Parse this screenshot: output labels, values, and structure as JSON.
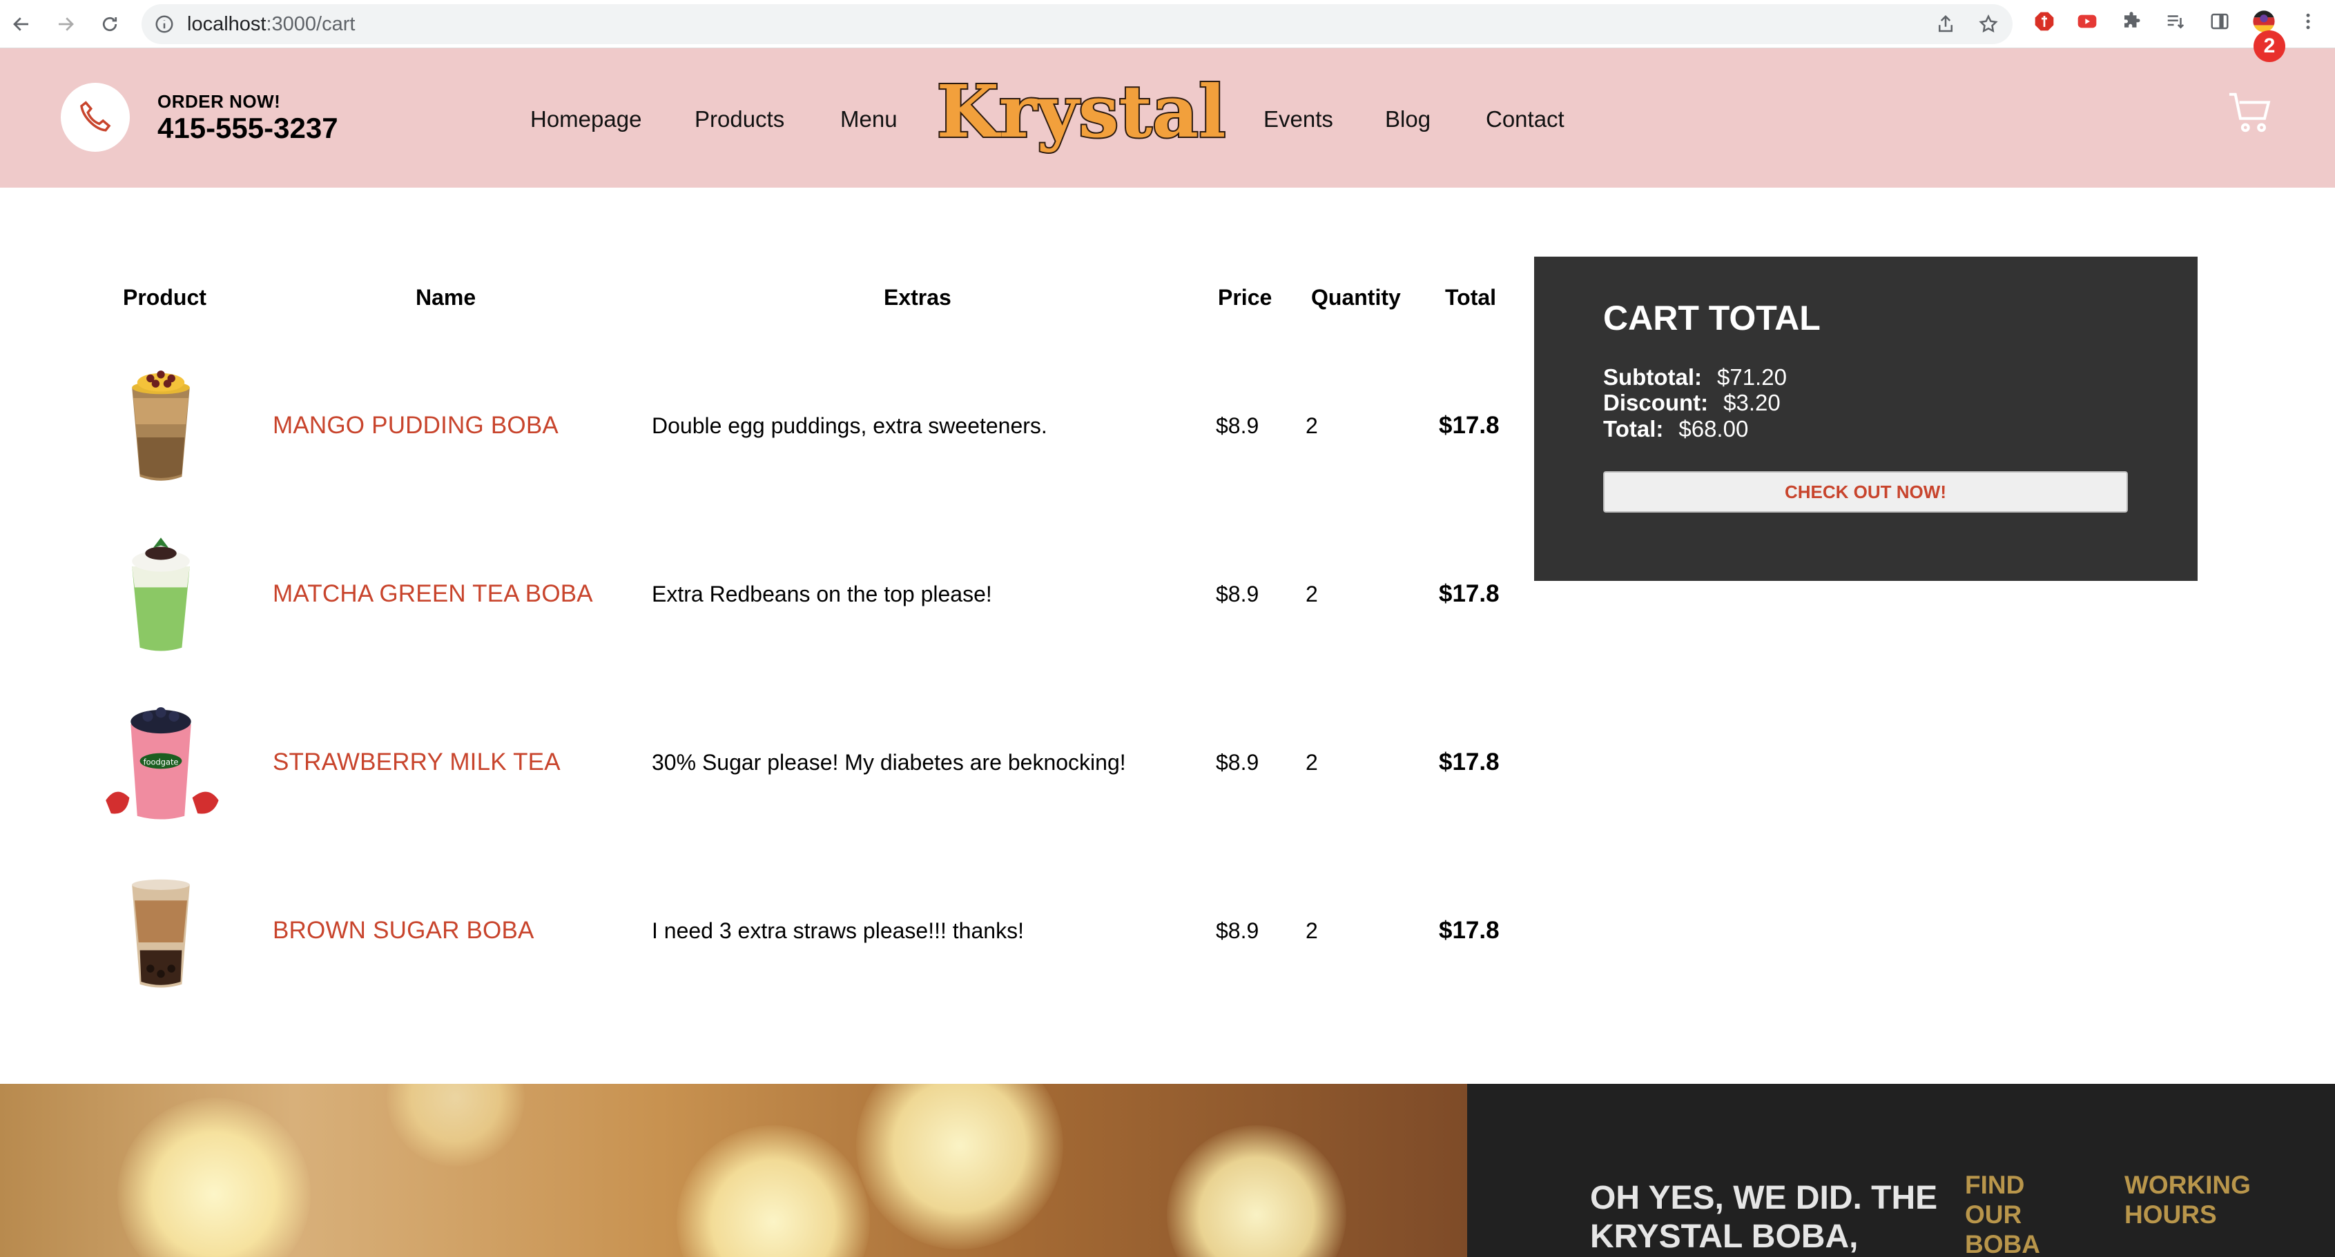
{
  "browser": {
    "url_host": "localhost",
    "url_path": ":3000/cart"
  },
  "header": {
    "order_label": "ORDER NOW!",
    "phone": "415-555-3237",
    "nav": [
      "Homepage",
      "Products",
      "Menu",
      "Events",
      "Blog",
      "Contact"
    ],
    "logo_text": "Krystal",
    "cart_count": "2",
    "background_color": "#efcaca"
  },
  "table": {
    "headers": {
      "product": "Product",
      "name": "Name",
      "extras": "Extras",
      "price": "Price",
      "quantity": "Quantity",
      "total": "Total"
    },
    "rows": [
      {
        "image": "mango-pudding-boba-image",
        "name": "MANGO PUDDING BOBA",
        "extras": "Double egg puddings, extra sweeteners.",
        "price": "$8.9",
        "quantity": "2",
        "total": "$17.8"
      },
      {
        "image": "matcha-green-tea-boba-image",
        "name": "MATCHA GREEN TEA BOBA",
        "extras": "Extra Redbeans on the top please!",
        "price": "$8.9",
        "quantity": "2",
        "total": "$17.8"
      },
      {
        "image": "strawberry-milk-tea-image",
        "name": "STRAWBERRY MILK TEA",
        "extras": "30% Sugar please! My diabetes are beknocking!",
        "price": "$8.9",
        "quantity": "2",
        "total": "$17.8"
      },
      {
        "image": "brown-sugar-boba-image",
        "name": "BROWN SUGAR BOBA",
        "extras": "I need 3 extra straws please!!! thanks!",
        "price": "$8.9",
        "quantity": "2",
        "total": "$17.8"
      }
    ]
  },
  "cart_total": {
    "title": "CART TOTAL",
    "subtotal_label": "Subtotal:",
    "subtotal": "$71.20",
    "discount_label": "Discount:",
    "discount": "$3.20",
    "total_label": "Total:",
    "total": "$68.00",
    "checkout_label": "CHECK OUT NOW!"
  },
  "footer": {
    "tagline": "OH YES, WE DID. THE KRYSTAL BOBA, WELL",
    "find_heading": "FIND OUR BOBA",
    "hours_heading": "WORKING HOURS"
  },
  "colors": {
    "accent": "#c8442c",
    "gold": "#b9964b",
    "dark_panel": "#333333",
    "badge": "#e8302c"
  }
}
